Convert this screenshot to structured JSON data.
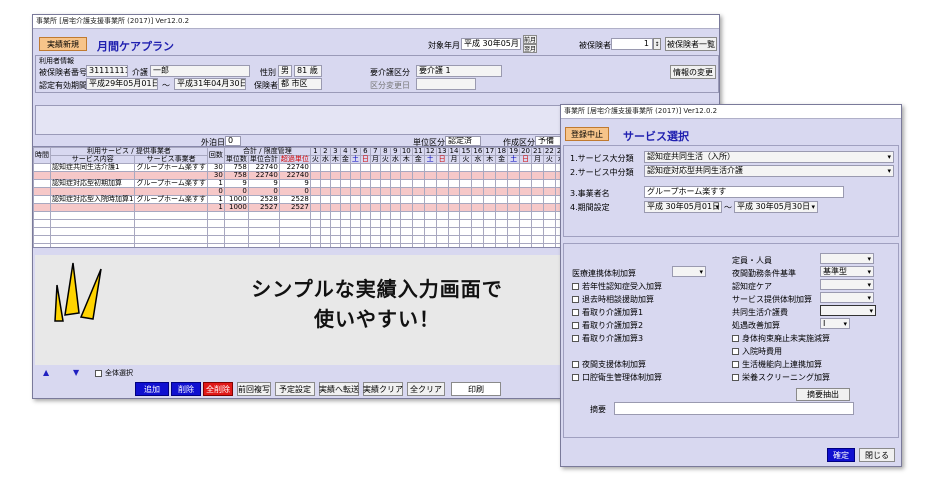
{
  "main": {
    "title": "事業所 [居宅介護支援事業所 (2017)] Ver12.0.2",
    "btn_new": "実績新規",
    "heading": "月間ケアプラン",
    "target_label": "対象年月",
    "target_value": "平成 30年05月",
    "prev_next": [
      "前月",
      "翌月"
    ],
    "id_label": "被保険者No",
    "id_value": "1",
    "btn_list": "被保険者一覧",
    "user_section": "利用者情報",
    "insured_label": "被保険者番号",
    "insured_value": "3111111111",
    "name_label": "介護",
    "name_value": "一郎",
    "sex_label": "性別",
    "sex_value": "男",
    "age_value": "81 歳",
    "care_label": "要介護区分",
    "care_value": "要介護 1",
    "period_label": "認定有効期間",
    "period_from": "平成29年05月01日",
    "period_to": "平成31年04月30日",
    "insurer_label": "保険者",
    "insurer_value": "都 市区",
    "change_label": "区分変更日",
    "btn_change_info": "情報の変更",
    "off_days_label": "外泊日数",
    "off_days_value": "0",
    "weekly_label": "単位区分",
    "weekly_value": "認定済",
    "make_label": "作成区分",
    "make_value": "予備",
    "hdr_service": "利用サービス / 提供事業者",
    "hdr_time": "時間",
    "hdr_content": "サービス内容",
    "hdr_provider": "サービス事業者",
    "hdr_count": "回数",
    "hdr_unit_group": "合計 / 限度管理",
    "hdr_unit_price": "単位数",
    "hdr_unit_total": "単位合計",
    "hdr_over": "超過単位",
    "days": [
      "1",
      "2",
      "3",
      "4",
      "5",
      "6",
      "7",
      "8",
      "9",
      "10",
      "11",
      "12",
      "13",
      "14",
      "15",
      "16",
      "17",
      "18",
      "19",
      "20",
      "21",
      "22",
      "23"
    ],
    "weekdays": [
      "火",
      "水",
      "木",
      "金",
      "土",
      "日",
      "月",
      "火",
      "水",
      "木",
      "金",
      "土",
      "日",
      "月",
      "火",
      "水",
      "木",
      "金",
      "土",
      "日",
      "月",
      "火",
      "水"
    ],
    "rows": [
      {
        "content": "認知症共同生活介護1",
        "provider": "グループホーム楽すす",
        "count": "30",
        "unit": "758",
        "total": "22740",
        "over": "22740",
        "pink": false
      },
      {
        "content": "",
        "provider": "",
        "count": "30",
        "unit": "758",
        "total": "22740",
        "over": "22740",
        "pink": true
      },
      {
        "content": "認知症対応型初期加算",
        "provider": "グループホーム楽すす",
        "count": "1",
        "unit": "9",
        "total": "9",
        "over": "9",
        "pink": false
      },
      {
        "content": "",
        "provider": "",
        "count": "0",
        "unit": "0",
        "total": "0",
        "over": "0",
        "pink": true
      },
      {
        "content": "認知症対応型入院時加算1",
        "provider": "グループホーム楽すす",
        "count": "1",
        "unit": "1000",
        "total": "2528",
        "over": "2528",
        "pink": false
      },
      {
        "content": "",
        "provider": "",
        "count": "1",
        "unit": "1000",
        "total": "2527",
        "over": "2527",
        "pink": true
      }
    ],
    "all_check_label": "全体選択",
    "bottom_buttons": [
      "追加",
      "削除",
      "全削除",
      "前回複写",
      "予定設定",
      "実績へ転送",
      "実績クリア",
      "全クリア",
      "印刷"
    ],
    "banner_line1": "シンプルな実績入力画面で",
    "banner_line2": "使いやすい！"
  },
  "dialog": {
    "title": "事業所 [居宅介護支援事業所 (2017)] Ver12.0.2",
    "btn_select": "登録中止",
    "heading": "サービス選択",
    "cat_big_label": "1.サービス大分類",
    "cat_big_value": "認知症共同生活（入所）",
    "cat_mid_label": "2.サービス中分類",
    "cat_mid_value": "認知症対応型共同生活介護",
    "provider_label": "3.事業者名",
    "provider_value": "グループホーム楽すす",
    "period_label": "4.期間設定",
    "period_from": "平成 30年05月01日",
    "period_to": "平成 30年05月30日",
    "opt_teiin": "定員・人員",
    "opt_yakan": "夜間勤務条件基準",
    "opt_yakan_value": "基準型",
    "opt_iryo": "医療連携体制加算",
    "opt_jakunen": "若年性認知症受入加算",
    "opt_ninchi": "認知症ケア",
    "opt_taiin": "退去時相談援助加算",
    "opt_service": "サービス提供体制加算",
    "opt_mitori1": "看取り介護加算1",
    "opt_kyodo": "共同生活介護費",
    "opt_mitori2": "看取り介護加算2",
    "opt_shokugu": "処遇改善加算",
    "opt_shokugu_value": "Ⅰ",
    "opt_mitori3": "看取り介護加算3",
    "opt_shintai": "身体拘束廃止未実施減算",
    "opt_nyuin": "入院時費用",
    "opt_yakan_shien": "夜間支援体制加算",
    "opt_seikatsu": "生活機能向上連携加算",
    "opt_koku": "口腔衛生管理体制加算",
    "opt_eiyo": "栄養スクリーニング加算",
    "btn_summary": "摘要抽出",
    "summary_label": "摘要",
    "btn_confirm": "確定",
    "btn_close": "閉じる"
  }
}
